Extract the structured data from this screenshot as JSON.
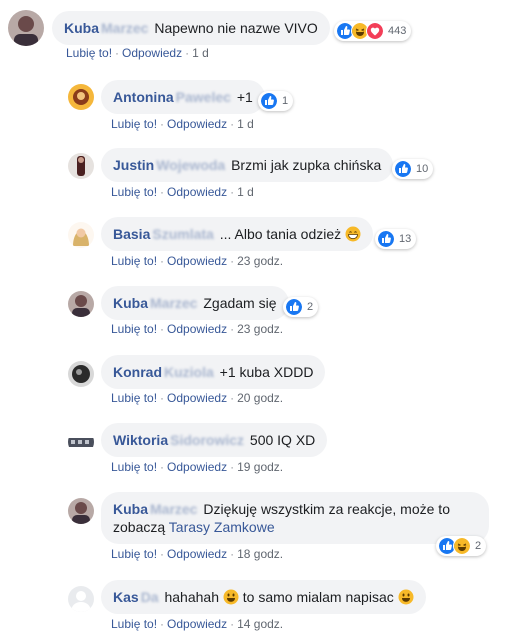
{
  "comments": [
    {
      "first_name": "Kuba",
      "surname": "Marzec",
      "text": "Napewno nie nazwe VIVO",
      "like": "Lubię to!",
      "reply": "Odpowiedz",
      "time": "1 d",
      "reaction_count": "443",
      "reaction_icons": [
        "like-icon",
        "haha-icon",
        "love-icon"
      ]
    },
    {
      "first_name": "Antonina",
      "surname": "Pawelec",
      "text": "+1",
      "like": "Lubię to!",
      "reply": "Odpowiedz",
      "time": "1 d",
      "reaction_count": "1",
      "reaction_icons": [
        "like-icon"
      ]
    },
    {
      "first_name": "Justin",
      "surname": "Wojewoda",
      "text": "Brzmi jak zupka chińska",
      "like": "Lubię to!",
      "reply": "Odpowiedz",
      "time": "1 d",
      "reaction_count": "10",
      "reaction_icons": [
        "like-icon"
      ]
    },
    {
      "first_name": "Basia",
      "surname": "Szumlata",
      "text": "... Albo tania odzież",
      "emoji": "grin-emoji",
      "like": "Lubię to!",
      "reply": "Odpowiedz",
      "time": "23 godz.",
      "reaction_count": "13",
      "reaction_icons": [
        "like-icon"
      ]
    },
    {
      "first_name": "Kuba",
      "surname": "Marzec",
      "text": "Zgadam się",
      "like": "Lubię to!",
      "reply": "Odpowiedz",
      "time": "23 godz.",
      "reaction_count": "2",
      "reaction_icons": [
        "like-icon"
      ]
    },
    {
      "first_name": "Konrad",
      "surname": "Kuziola",
      "text": "+1 kuba XDDD",
      "like": "Lubię to!",
      "reply": "Odpowiedz",
      "time": "20 godz."
    },
    {
      "first_name": "Wiktoria",
      "surname": "Sidorowicz",
      "text": "500 IQ XD",
      "like": "Lubię to!",
      "reply": "Odpowiedz",
      "time": "19 godz."
    },
    {
      "first_name": "Kuba",
      "surname": "Marzec",
      "text": "Dziękuję wszystkim za reakcje, może to zobaczą",
      "link": "Tarasy Zamkowe",
      "like": "Lubię to!",
      "reply": "Odpowiedz",
      "time": "18 godz.",
      "reaction_count": "2",
      "reaction_icons": [
        "like-icon",
        "haha-icon"
      ]
    },
    {
      "first_name": "Kas",
      "surname": "Da",
      "text": "hahahah",
      "text_2": "to samo mialam napisac",
      "like": "Lubię to!",
      "reply": "Odpowiedz",
      "time": "14 godz."
    }
  ],
  "colors": {
    "author": "#385898",
    "bubble": "#f2f3f5",
    "meta": "#616770",
    "like_blue": "#1877f2",
    "love_red": "#f33e58",
    "haha_yellow": "#f7b928"
  }
}
